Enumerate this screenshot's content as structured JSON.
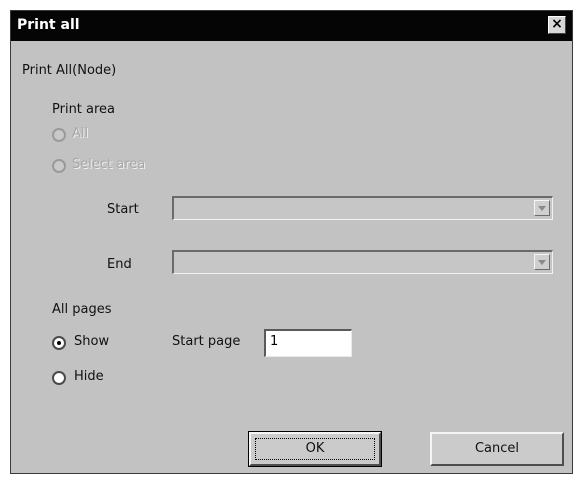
{
  "window": {
    "title": "Print all",
    "close_glyph": "×"
  },
  "heading": "Print All(Node)",
  "print_area": {
    "label": "Print area",
    "options": [
      {
        "label": "All",
        "selected": false,
        "enabled": false
      },
      {
        "label": "Select area",
        "selected": false,
        "enabled": false
      }
    ],
    "start_label": "Start",
    "end_label": "End",
    "start_value": "",
    "end_value": ""
  },
  "all_pages": {
    "label": "All pages",
    "show_label": "Show",
    "hide_label": "Hide",
    "selected": "Show",
    "start_page_label": "Start page",
    "start_page_value": "1"
  },
  "buttons": {
    "ok": "OK",
    "cancel": "Cancel"
  }
}
